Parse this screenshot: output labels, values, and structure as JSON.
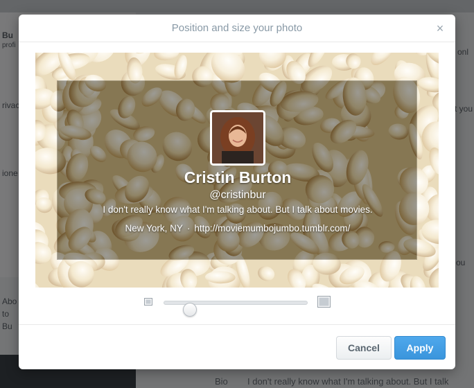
{
  "background": {
    "fragments": [
      "Bu",
      "profi",
      "rivac",
      "ione",
      "Abo",
      "to",
      "Bu",
      "onl",
      "t you",
      "ou"
    ],
    "bio_label": "Bio",
    "bio_value": "I don't really know what I'm talking about. But I talk"
  },
  "modal": {
    "title": "Position and size your photo",
    "close_label": "×"
  },
  "profile": {
    "name": "Cristin Burton",
    "handle": "@cristinbur",
    "bio": "I don't really know what I'm talking about. But I talk about movies.",
    "location": "New York, NY",
    "separator": "·",
    "url": "http://moviemumbojumbo.tumblr.com/"
  },
  "zoom": {
    "small_icon": "image-small-icon",
    "large_icon": "image-large-icon",
    "level": 0.1
  },
  "footer": {
    "cancel_label": "Cancel",
    "apply_label": "Apply"
  },
  "colors": {
    "apply": "#3a95dc",
    "title": "#8899a6",
    "overlay": "rgba(0,0,0,0.5)"
  }
}
